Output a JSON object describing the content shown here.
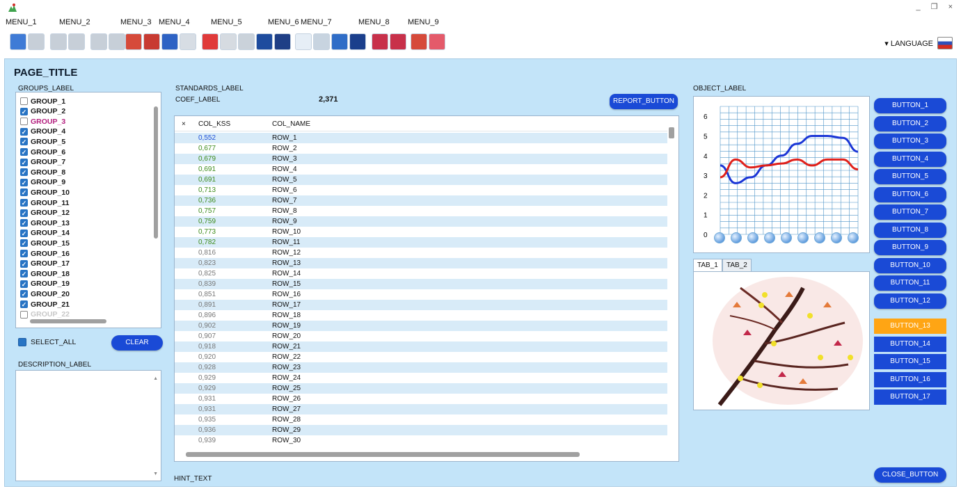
{
  "menu": [
    "MENU_1",
    "MENU_2",
    "MENU_3",
    "MENU_4",
    "MENU_5",
    "MENU_6",
    "MENU_7",
    "MENU_8",
    "MENU_9"
  ],
  "language": "LANGUAGE",
  "page_title": "PAGE_TITLE",
  "groups": {
    "label": "GROUPS_LABEL",
    "items": [
      {
        "label": "GROUP_1",
        "checked": false,
        "style": "normal"
      },
      {
        "label": "GROUP_2",
        "checked": true,
        "style": "normal"
      },
      {
        "label": "GROUP_3",
        "checked": false,
        "style": "pink"
      },
      {
        "label": "GROUP_4",
        "checked": true,
        "style": "normal"
      },
      {
        "label": "GROUP_5",
        "checked": true,
        "style": "normal"
      },
      {
        "label": "GROUP_6",
        "checked": true,
        "style": "normal"
      },
      {
        "label": "GROUP_7",
        "checked": true,
        "style": "normal"
      },
      {
        "label": "GROUP_8",
        "checked": true,
        "style": "normal"
      },
      {
        "label": "GROUP_9",
        "checked": true,
        "style": "normal"
      },
      {
        "label": "GROUP_10",
        "checked": true,
        "style": "normal"
      },
      {
        "label": "GROUP_11",
        "checked": true,
        "style": "normal"
      },
      {
        "label": "GROUP_12",
        "checked": true,
        "style": "normal"
      },
      {
        "label": "GROUP_13",
        "checked": true,
        "style": "normal"
      },
      {
        "label": "GROUP_14",
        "checked": true,
        "style": "normal"
      },
      {
        "label": "GROUP_15",
        "checked": true,
        "style": "normal"
      },
      {
        "label": "GROUP_16",
        "checked": true,
        "style": "normal"
      },
      {
        "label": "GROUP_17",
        "checked": true,
        "style": "normal"
      },
      {
        "label": "GROUP_18",
        "checked": true,
        "style": "normal"
      },
      {
        "label": "GROUP_19",
        "checked": true,
        "style": "normal"
      },
      {
        "label": "GROUP_20",
        "checked": true,
        "style": "normal"
      },
      {
        "label": "GROUP_21",
        "checked": true,
        "style": "normal"
      },
      {
        "label": "GROUP_22",
        "checked": false,
        "style": "grey"
      }
    ]
  },
  "select_all_label": "SELECT_ALL",
  "clear_button": "CLEAR",
  "description_label": "DESCRIPTION_LABEL",
  "standards": {
    "label": "STANDARDS_LABEL",
    "coef_label": "COEF_LABEL",
    "coef_value": "2,371",
    "report_button": "REPORT_BUTTON",
    "columns": [
      "×",
      "COL_KSS",
      "COL_NAME"
    ],
    "rows": [
      {
        "k": "0,552",
        "name": "ROW_1",
        "color": "blue"
      },
      {
        "k": "0,677",
        "name": "ROW_2",
        "color": "green"
      },
      {
        "k": "0,679",
        "name": "ROW_3",
        "color": "green"
      },
      {
        "k": "0,691",
        "name": "ROW_4",
        "color": "green"
      },
      {
        "k": "0,691",
        "name": "ROW_5",
        "color": "green"
      },
      {
        "k": "0,713",
        "name": "ROW_6",
        "color": "green"
      },
      {
        "k": "0,736",
        "name": "ROW_7",
        "color": "green"
      },
      {
        "k": "0,757",
        "name": "ROW_8",
        "color": "green"
      },
      {
        "k": "0,759",
        "name": "ROW_9",
        "color": "green"
      },
      {
        "k": "0,773",
        "name": "ROW_10",
        "color": "green"
      },
      {
        "k": "0,782",
        "name": "ROW_11",
        "color": "green"
      },
      {
        "k": "0,816",
        "name": "ROW_12",
        "color": "grey"
      },
      {
        "k": "0,823",
        "name": "ROW_13",
        "color": "grey"
      },
      {
        "k": "0,825",
        "name": "ROW_14",
        "color": "grey"
      },
      {
        "k": "0,839",
        "name": "ROW_15",
        "color": "grey"
      },
      {
        "k": "0,851",
        "name": "ROW_16",
        "color": "grey"
      },
      {
        "k": "0,891",
        "name": "ROW_17",
        "color": "grey"
      },
      {
        "k": "0,896",
        "name": "ROW_18",
        "color": "grey"
      },
      {
        "k": "0,902",
        "name": "ROW_19",
        "color": "grey"
      },
      {
        "k": "0,907",
        "name": "ROW_20",
        "color": "grey"
      },
      {
        "k": "0,918",
        "name": "ROW_21",
        "color": "grey"
      },
      {
        "k": "0,920",
        "name": "ROW_22",
        "color": "grey"
      },
      {
        "k": "0,928",
        "name": "ROW_23",
        "color": "grey"
      },
      {
        "k": "0,929",
        "name": "ROW_24",
        "color": "grey"
      },
      {
        "k": "0,929",
        "name": "ROW_25",
        "color": "grey"
      },
      {
        "k": "0,931",
        "name": "ROW_26",
        "color": "grey"
      },
      {
        "k": "0,931",
        "name": "ROW_27",
        "color": "grey"
      },
      {
        "k": "0,935",
        "name": "ROW_28",
        "color": "grey"
      },
      {
        "k": "0,936",
        "name": "ROW_29",
        "color": "grey"
      },
      {
        "k": "0,939",
        "name": "ROW_30",
        "color": "grey"
      }
    ]
  },
  "hint": "HINT_TEXT",
  "object_label": "OBJECT_LABEL",
  "chart_data": {
    "type": "line",
    "y_ticks": [
      "6",
      "5",
      "4",
      "3",
      "2",
      "1",
      "0"
    ],
    "ylim": [
      0,
      6.5
    ],
    "grid": true,
    "series": [
      {
        "color": "#1a35d6",
        "values": [
          3.5,
          2.6,
          2.9,
          3.5,
          4.0,
          4.6,
          5.0,
          5.0,
          4.9,
          4.2
        ]
      },
      {
        "color": "#e0201a",
        "values": [
          2.9,
          3.8,
          3.4,
          3.5,
          3.6,
          3.8,
          3.5,
          3.8,
          3.8,
          3.3
        ]
      }
    ]
  },
  "organ_tabs": [
    "TAB_1",
    "TAB_2"
  ],
  "right_buttons": [
    "BUTTON_1",
    "BUTTON_2",
    "BUTTON_3",
    "BUTTON_4",
    "BUTTON_5",
    "BUTTON_6",
    "BUTTON_7",
    "BUTTON_8",
    "BUTTON_9",
    "BUTTON_10",
    "BUTTON_11",
    "BUTTON_12"
  ],
  "action_buttons": [
    {
      "label": "BUTTON_13",
      "active": true
    },
    {
      "label": "BUTTON_14",
      "active": false
    },
    {
      "label": "BUTTON_15",
      "active": false
    },
    {
      "label": "BUTTON_16",
      "active": false
    },
    {
      "label": "BUTTON_17",
      "active": false
    }
  ],
  "close_button": "CLOSE_BUTTON"
}
